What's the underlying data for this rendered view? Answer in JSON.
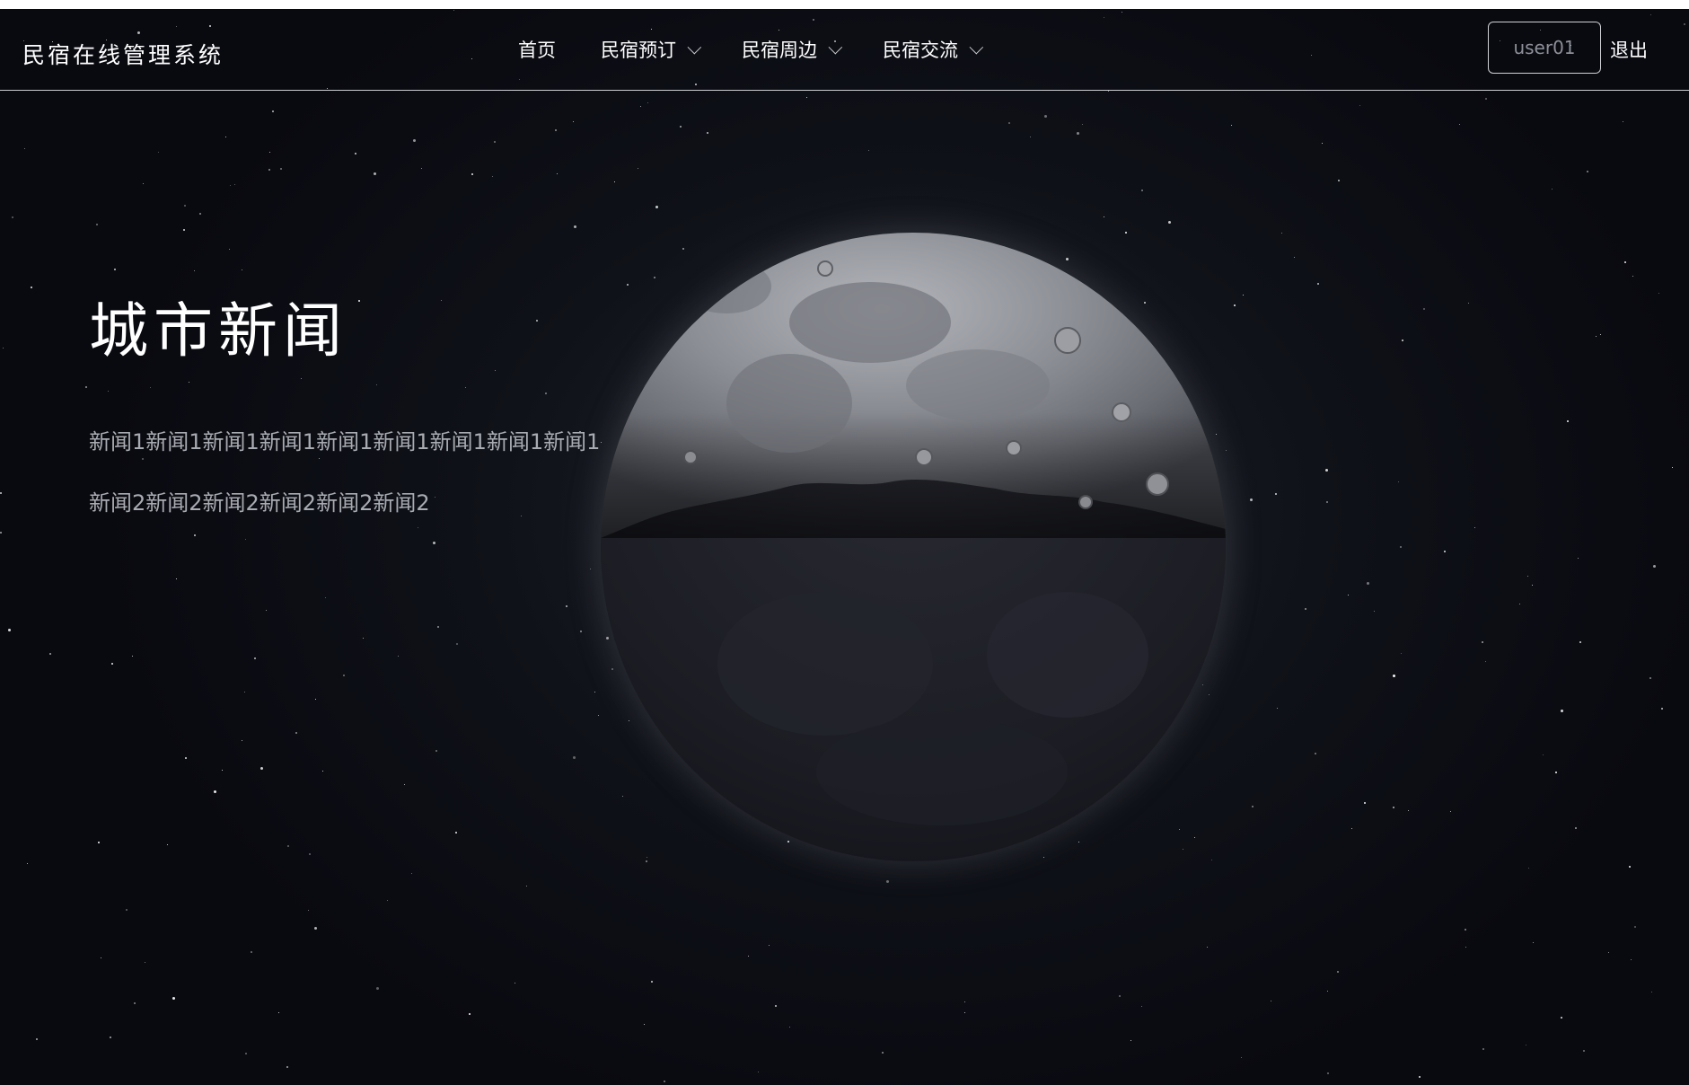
{
  "header": {
    "brand": "民宿在线管理系统",
    "nav": [
      {
        "label": "首页",
        "has_dropdown": false
      },
      {
        "label": "民宿预订",
        "has_dropdown": true
      },
      {
        "label": "民宿周边",
        "has_dropdown": true
      },
      {
        "label": "民宿交流",
        "has_dropdown": true
      }
    ],
    "username": "user01",
    "logout_label": "退出"
  },
  "main": {
    "title": "城市新闻",
    "news": [
      "新闻1新闻1新闻1新闻1新闻1新闻1新闻1新闻1新闻1",
      "新闻2新闻2新闻2新闻2新闻2新闻2"
    ]
  },
  "icons": {
    "dropdown": "chevron-down-icon"
  }
}
